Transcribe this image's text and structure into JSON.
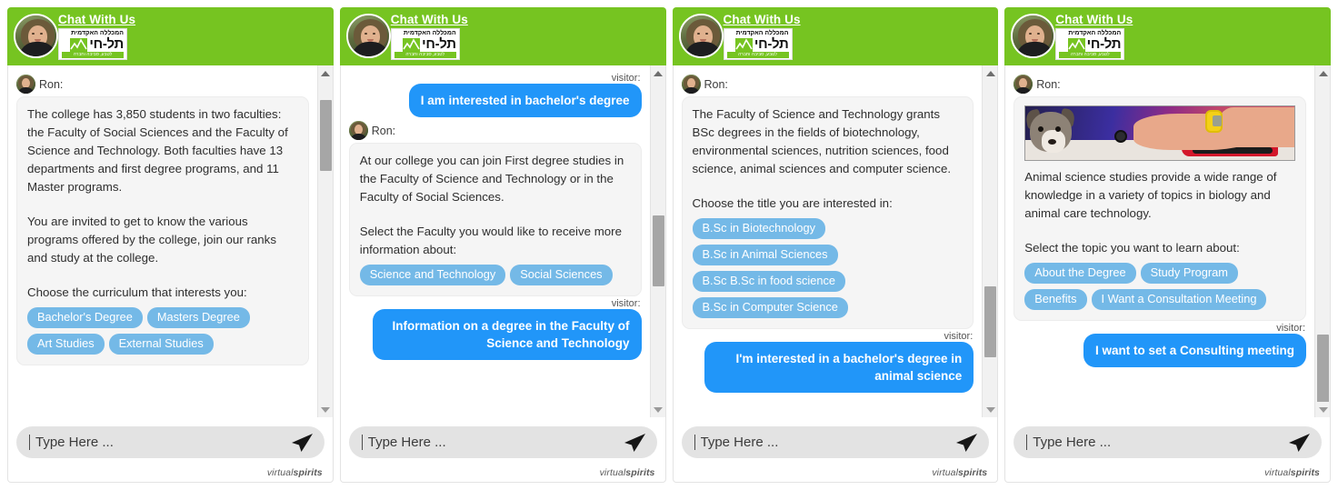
{
  "header": {
    "chat_title": "Chat With Us",
    "logo_line1": "המכללה האקדמית",
    "logo_line2": "תל-חי",
    "logo_line3": "לטבע, סביבה וחברה",
    "avatar_name": "avatar"
  },
  "labels": {
    "sender": "Ron:",
    "visitor": "visitor:"
  },
  "composer": {
    "placeholder": "Type Here ...",
    "value": "",
    "send_label": "send"
  },
  "footer": {
    "brand_light": "virtual",
    "brand_bold": "spirits"
  },
  "colors": {
    "header_green": "#76c421",
    "visitor_blue": "#2196f9",
    "quick_reply_blue": "#74b9e7",
    "bot_bubble_bg": "#f5f5f5"
  },
  "panels": [
    {
      "id": "panel-1",
      "scroll_thumb_top_pct": 6,
      "scroll_thumb_height_pct": 22,
      "messages": [
        {
          "type": "bot",
          "sender": "Ron:",
          "paragraphs": [
            "The college has 3,850 students in two faculties: the Faculty of Social Sciences and the Faculty of Science and Technology. Both faculties have 13 departments and first degree programs, and 11 Master programs.",
            "You are invited to get to know the various programs offered by the college, join our ranks and study at the college."
          ],
          "prompt": "Choose the curriculum that interests you:",
          "quick_replies": [
            "Bachelor's Degree",
            "Masters Degree",
            "Art Studies",
            "External Studies"
          ]
        }
      ]
    },
    {
      "id": "panel-2",
      "scroll_thumb_top_pct": 42,
      "scroll_thumb_height_pct": 22,
      "messages": [
        {
          "type": "visitor",
          "label": "visitor:",
          "text": "I am interested in bachelor's degree"
        },
        {
          "type": "bot",
          "sender": "Ron:",
          "paragraphs": [
            "At our college you can join First degree studies in the Faculty of Science and Technology or in the Faculty of Social Sciences."
          ],
          "prompt": "Select the Faculty you would like to receive more information about:",
          "quick_replies": [
            "Science and Technology",
            "Social Sciences"
          ]
        },
        {
          "type": "visitor",
          "label": "visitor:",
          "text": "Information on a degree in the Faculty of Science and Technology"
        }
      ]
    },
    {
      "id": "panel-3",
      "scroll_thumb_top_pct": 64,
      "scroll_thumb_height_pct": 22,
      "messages": [
        {
          "type": "bot",
          "sender": "Ron:",
          "paragraphs": [
            "The Faculty of Science and Technology grants BSc degrees in the fields of biotechnology, environmental sciences, nutrition sciences, food science, animal sciences and computer science."
          ],
          "prompt": "Choose the title you are interested in:",
          "quick_replies_stacked": true,
          "quick_replies": [
            "B.Sc in Biotechnology",
            "B.Sc in Animal Sciences",
            "B.Sc B.Sc in food science",
            "B.Sc in Computer Science"
          ]
        },
        {
          "type": "visitor",
          "label": "visitor:",
          "text": "I'm interested in a bachelor's degree in animal science"
        }
      ]
    },
    {
      "id": "panel-4",
      "scroll_thumb_top_pct": 79,
      "scroll_thumb_height_pct": 22,
      "messages": [
        {
          "type": "bot",
          "sender": "Ron:",
          "has_image": true,
          "image_alt": "puppy-examination-photo",
          "paragraphs": [
            "Animal science studies provide a wide range of knowledge in a variety of topics in biology and animal care technology."
          ],
          "prompt": "Select the topic you want to learn about:",
          "quick_replies": [
            "About the Degree",
            "Study Program",
            "Benefits",
            "I Want a Consultation Meeting"
          ]
        },
        {
          "type": "visitor",
          "label": "visitor:",
          "text": "I want to set a Consulting meeting"
        }
      ]
    }
  ]
}
